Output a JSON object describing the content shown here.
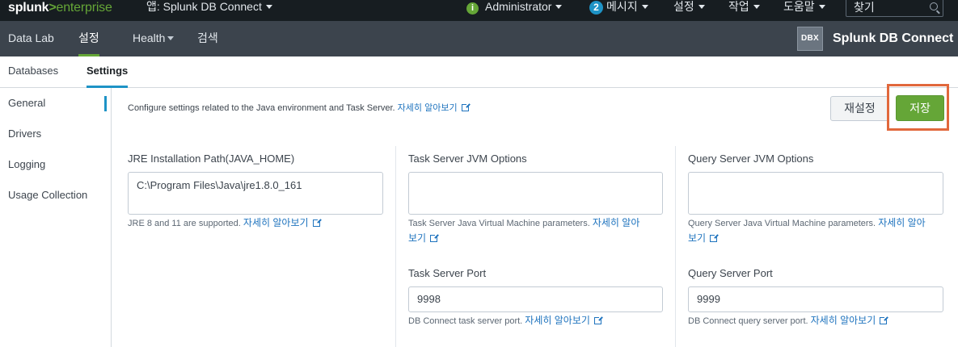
{
  "topbar": {
    "logo_splunk": "splunk",
    "logo_gt": ">",
    "logo_enterprise": "enterprise",
    "app_menu": "앱: Splunk DB Connect",
    "user_menu": "Administrator",
    "messages_count": "2",
    "messages_menu": "메시지",
    "settings_menu": "설정",
    "activity_menu": "작업",
    "help_menu": "도움말",
    "search_placeholder": "찾기"
  },
  "appbar": {
    "nav": [
      "Data Lab",
      "설정",
      "Health",
      "검색"
    ],
    "logo_text": "DBX",
    "title": "Splunk DB Connect"
  },
  "subtabs": [
    "Databases",
    "Settings"
  ],
  "sidenav": [
    "General",
    "Drivers",
    "Logging",
    "Usage Collection"
  ],
  "main": {
    "description": "Configure settings related to the Java environment and Task Server.",
    "learn_more": "자세히 알아보기",
    "reset_label": "재설정",
    "save_label": "저장",
    "jre": {
      "label": "JRE Installation Path(JAVA_HOME)",
      "value": "C:\\Program Files\\Java\\jre1.8.0_161",
      "help": "JRE 8 and 11 are supported."
    },
    "task_jvm": {
      "label": "Task Server JVM Options",
      "value": "",
      "help": "Task Server Java Virtual Machine parameters.",
      "learn_more_1": "자세히 알아",
      "learn_more_2": "보기"
    },
    "query_jvm": {
      "label": "Query Server JVM Options",
      "value": "",
      "help": "Query Server Java Virtual Machine parameters.",
      "learn_more_1": "자세히 알아",
      "learn_more_2": "보기"
    },
    "task_port": {
      "label": "Task Server Port",
      "value": "9998",
      "help": "DB Connect task server port."
    },
    "query_port": {
      "label": "Query Server Port",
      "value": "9999",
      "help": "DB Connect query server port."
    }
  }
}
